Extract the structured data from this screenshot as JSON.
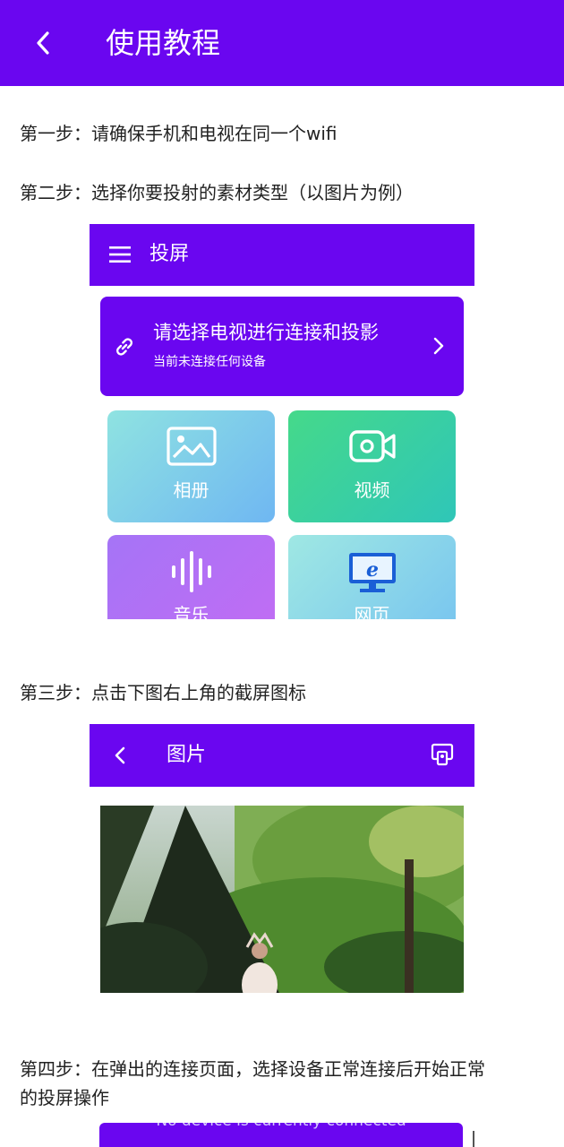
{
  "header": {
    "title": "使用教程"
  },
  "steps": [
    "第一步：请确保手机和电视在同一个wifi",
    "第二步：选择你要投射的素材类型（以图片为例）",
    "第三步：点击下图右上角的截屏图标",
    "第四步：在弹出的连接页面，选择设备正常连接后开始正常",
    "的投屏操作"
  ],
  "mock_cast": {
    "title": "投屏",
    "card_title": "请选择电视进行连接和投影",
    "card_subtitle": "当前未连接任何设备",
    "tiles": [
      {
        "label": "相册",
        "icon": "photo-icon"
      },
      {
        "label": "视频",
        "icon": "video-camera-icon"
      },
      {
        "label": "音乐",
        "icon": "sound-wave-icon"
      },
      {
        "label": "网页",
        "icon": "browser-monitor-icon"
      }
    ]
  },
  "mock_picture": {
    "title": "图片",
    "cast_icon": "cast-screen-icon"
  },
  "mock_connect": {
    "status": "No device is currently connected"
  },
  "colors": {
    "brand": "#6a06f0"
  }
}
